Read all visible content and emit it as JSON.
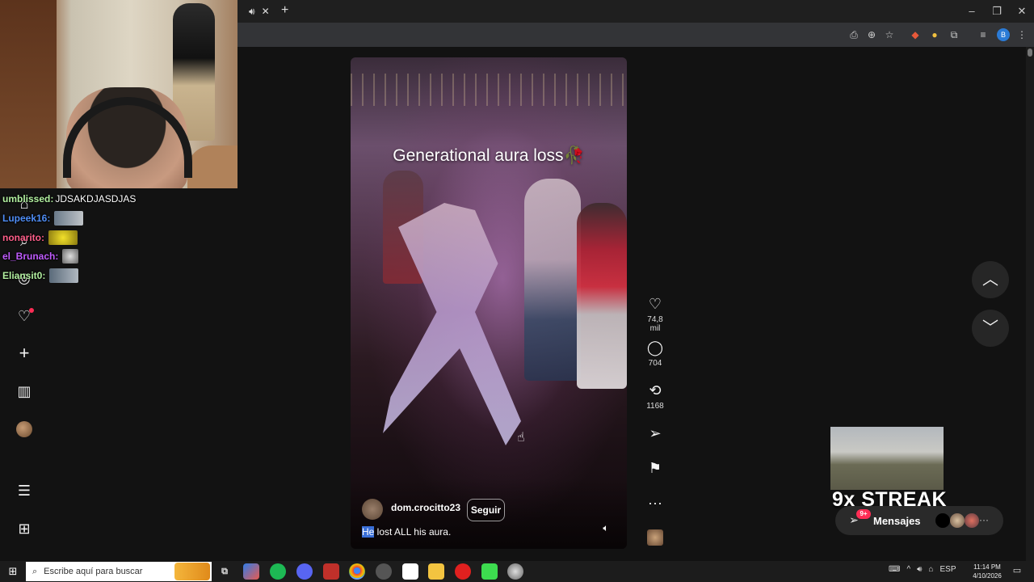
{
  "browser": {
    "tab_close": "✕",
    "new_tab": "+",
    "window_controls": [
      "–",
      "❐",
      "✕"
    ],
    "profile_initial": "B"
  },
  "webcam": {
    "label": ""
  },
  "chat": [
    {
      "user": "umblissed:",
      "message": "JDSAKDJASDJAS",
      "color": "#b2f0a0"
    },
    {
      "user": "Lupeek16:",
      "message": "",
      "color": "#4f8df5"
    },
    {
      "user": "nonarito:",
      "message": "",
      "color": "#ff5f8a"
    },
    {
      "user": "el_Brunach:",
      "message": "",
      "color": "#c05cff"
    },
    {
      "user": "Eliansit0:",
      "message": "",
      "color": "#b2f0a0"
    }
  ],
  "left_nav": {
    "icons": [
      "home-icon",
      "search-icon",
      "compass-icon",
      "heart-icon",
      "plus-icon",
      "chart-icon",
      "profile-avatar",
      "menu-icon",
      "apps-icon"
    ]
  },
  "video": {
    "overlay_caption": "Generational aura loss🥀",
    "author": "dom.crocitto23",
    "follow_label": "Seguir",
    "caption_highlight": "He",
    "caption_rest": " lost ALL his aura."
  },
  "actions": {
    "likes": "74,8 mil",
    "comments": "704",
    "reposts": "1168",
    "more": "···"
  },
  "streak": {
    "text": "9x STREAK",
    "messages_label": "Mensajes",
    "badge": "9+"
  },
  "taskbar": {
    "search_placeholder": "Escribe aquí para buscar",
    "language": "ESP",
    "time": "11:14 PM",
    "date": "4/10/2026"
  },
  "colors": {
    "page_bg": "#121212",
    "chrome_bg": "#1f1f1f",
    "toolbar_bg": "#333437",
    "accent": "#ff2d55"
  }
}
